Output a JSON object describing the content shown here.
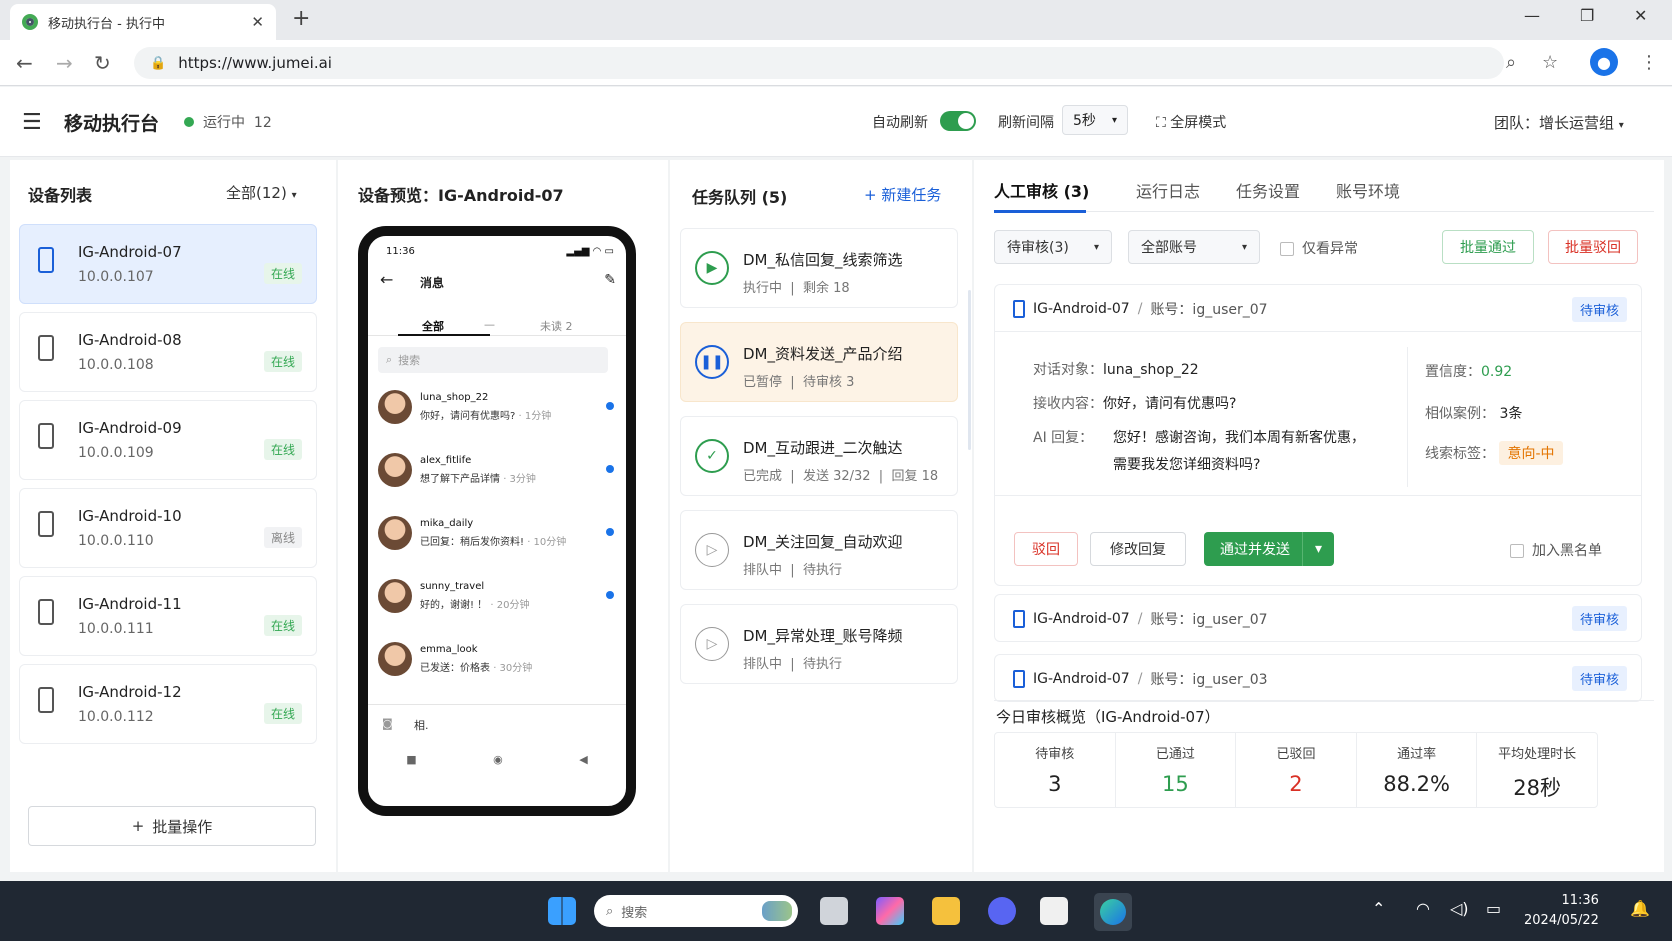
{
  "browser": {
    "tab_title": "移动执行台 - 执行中",
    "url": "https://www.jumei.ai"
  },
  "header": {
    "title": "移动执行台",
    "status_label": "运行中",
    "status_count": "12",
    "auto_refresh_label": "自动刷新",
    "auto_refresh_on": true,
    "interval_label": "刷新间隔",
    "interval_value": "5秒",
    "fullscreen_label": "全屏模式",
    "team_label": "团队：增长运营组"
  },
  "devices": {
    "title": "设备列表",
    "filter": "全部(12)",
    "items": [
      {
        "name": "IG-Android-07",
        "ip": "10.0.0.107",
        "status": "在线",
        "online": true,
        "selected": true
      },
      {
        "name": "IG-Android-08",
        "ip": "10.0.0.108",
        "status": "在线",
        "online": true
      },
      {
        "name": "IG-Android-09",
        "ip": "10.0.0.109",
        "status": "在线",
        "online": true
      },
      {
        "name": "IG-Android-10",
        "ip": "10.0.0.110",
        "status": "离线",
        "online": false
      },
      {
        "name": "IG-Android-11",
        "ip": "10.0.0.111",
        "status": "在线",
        "online": true
      },
      {
        "name": "IG-Android-12",
        "ip": "10.0.0.112",
        "status": "在线",
        "online": true
      }
    ],
    "batch_label": "批量操作"
  },
  "preview": {
    "title": "设备预览：IG-Android-07",
    "phone": {
      "time": "11:36",
      "screen_title": "消息",
      "tabs": [
        "全部",
        "—",
        "未读 2"
      ],
      "search_placeholder": "搜索",
      "messages": [
        {
          "name": "luna_shop_22",
          "text": "你好，请问有优惠吗?",
          "time": "· 1分钟",
          "unread": true
        },
        {
          "name": "alex_fitlife",
          "text": "想了解下产品详情",
          "time": "· 3分钟",
          "unread": true
        },
        {
          "name": "mika_daily",
          "text": "已回复：稍后发你资料!",
          "time": "· 10分钟",
          "unread": true
        },
        {
          "name": "sunny_travel",
          "text": "好的，谢谢! ！",
          "time": "· 20分钟",
          "unread": true
        },
        {
          "name": "emma_look",
          "text": "已发送：价格表",
          "time": "· 30分钟",
          "unread": false
        }
      ],
      "input_text": "相."
    }
  },
  "tasks": {
    "title": "任务队列 (5)",
    "new_label": "新建任务",
    "items": [
      {
        "name": "DM_私信回复_线索筛选",
        "state": "执行中",
        "detail": "剩余 18",
        "icon": "play"
      },
      {
        "name": "DM_资料发送_产品介绍",
        "state": "已暂停",
        "detail": "待审核 3",
        "icon": "pause"
      },
      {
        "name": "DM_互动跟进_二次触达",
        "state": "已完成",
        "detail": "发送 32/32",
        "detail2": "回复 18",
        "icon": "check"
      },
      {
        "name": "DM_关注回复_自动欢迎",
        "state": "排队中",
        "detail": "待执行",
        "icon": "queued"
      },
      {
        "name": "DM_异常处理_账号降频",
        "state": "排队中",
        "detail": "待执行",
        "icon": "queued"
      }
    ]
  },
  "review": {
    "tabs": [
      "人工审核 (3)",
      "运行日志",
      "任务设置",
      "账号环境"
    ],
    "filter_status": "待审核(3)",
    "filter_account": "全部账号",
    "only_abnormal": "仅看异常",
    "batch_pass": "批量通过",
    "batch_reject": "批量驳回",
    "main_card": {
      "device": "IG-Android-07",
      "account": "账号：ig_user_07",
      "badge": "待审核",
      "target_label": "对话对象：",
      "target": "luna_shop_22",
      "received_label": "接收内容：",
      "received": "你好，请问有优惠吗?",
      "ai_label": "AI 回复：",
      "ai_line1": "您好！感谢咨询，我们本周有新客优惠，",
      "ai_line2": "需要我发您详细资料吗?",
      "confidence_label": "置信度：",
      "confidence": "0.92",
      "similar_label": "相似案例：",
      "similar": "3条",
      "lead_label": "线索标签：",
      "lead_tag": "意向-中",
      "reject_btn": "驳回",
      "edit_btn": "修改回复",
      "send_btn": "通过并发送",
      "blacklist": "加入黑名单"
    },
    "other_cards": [
      {
        "device": "IG-Android-07",
        "account": "账号：ig_user_07",
        "badge": "待审核"
      },
      {
        "device": "IG-Android-07",
        "account": "账号：ig_user_03",
        "badge": "待审核"
      }
    ],
    "overview": {
      "title": "今日审核概览（IG-Android-07）",
      "stats": [
        {
          "label": "待审核",
          "value": "3",
          "color": "#222222"
        },
        {
          "label": "已通过",
          "value": "15",
          "color": "#2e9d4f"
        },
        {
          "label": "已驳回",
          "value": "2",
          "color": "#d93025"
        },
        {
          "label": "通过率",
          "value": "88.2%",
          "color": "#222222"
        },
        {
          "label": "平均处理时长",
          "value": "28秒",
          "color": "#222222"
        }
      ]
    }
  },
  "taskbar": {
    "search_placeholder": "搜索",
    "time": "11:36",
    "date": "2024/05/22"
  },
  "colors": {
    "accent": "#1a5fd8",
    "success": "#2e9d4f",
    "danger": "#d93025",
    "warning": "#e37400"
  }
}
